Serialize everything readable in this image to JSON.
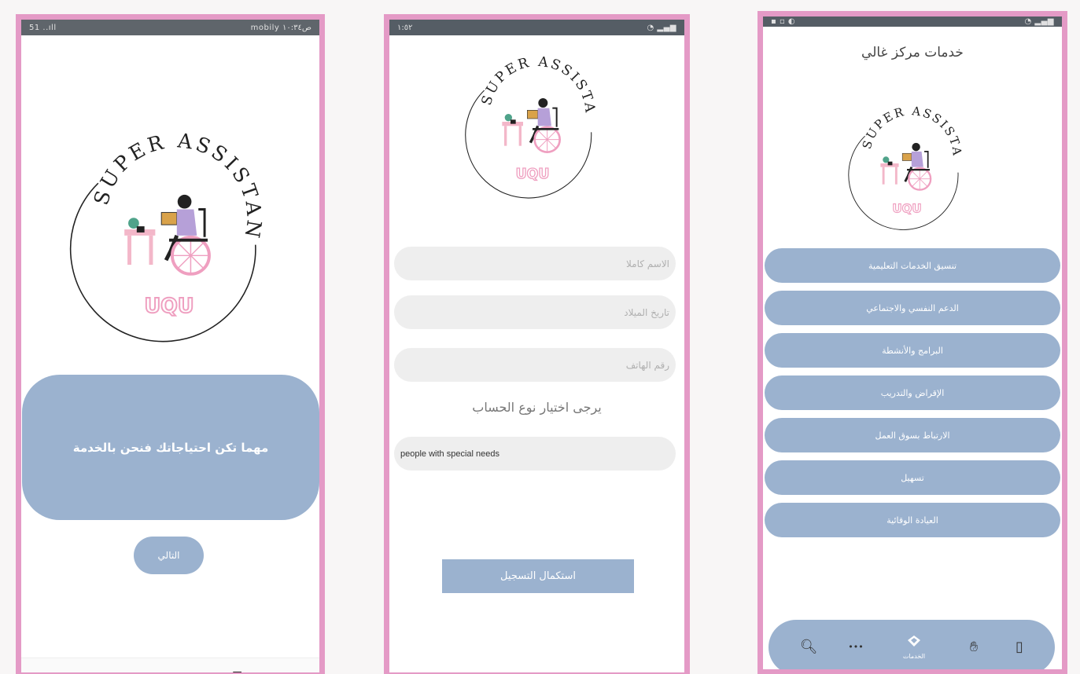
{
  "colors": {
    "frame": "#e49ac6",
    "accent": "#9bb2cf",
    "field": "#eeeeee",
    "logo_pink": "#ef9fc0"
  },
  "logo": {
    "arc_text": "SUPER ASSISTANT",
    "badge": "UQU"
  },
  "screen1": {
    "status_right": "mobily ص١٠:٣٤",
    "status_left": "51 ..ıll",
    "slogan": "مهما تكن احتياجاتك فنحن بالخدمة",
    "next_label": "التالي",
    "nav": {
      "back_icon": "back-triangle-icon",
      "home_icon": "home-circle-icon",
      "recent_icon": "recent-square-icon"
    }
  },
  "screen2": {
    "status_left": "١:٥٢",
    "fields": [
      {
        "placeholder": "الاسم كاملا"
      },
      {
        "placeholder": "تاريخ الميلاد"
      },
      {
        "placeholder": "رقم الهاتف"
      }
    ],
    "account_prompt": "يرجى اختيار نوع الحساب",
    "account_type": "people with special needs",
    "submit_label": "استكمال التسجيل"
  },
  "screen3": {
    "title": "خدمات مركز غالي",
    "services": [
      "تنسيق الخدمات التعليمية",
      "الدعم النفسي والاجتماعي",
      "البرامج والأنشطة",
      "الإقراض والتدريب",
      "الارتباط بسوق العمل",
      "تسهيل",
      "العيادة الوقائية"
    ],
    "bottom_nav": [
      {
        "icon": "search-icon",
        "glyph": "🔍︎"
      },
      {
        "icon": "more-icon",
        "glyph": "•••"
      },
      {
        "icon": "services-icon",
        "label": "الخدمات"
      },
      {
        "icon": "sign-language-hand-icon",
        "glyph": "✋︎"
      },
      {
        "icon": "map-icon",
        "glyph": "▯"
      }
    ]
  }
}
